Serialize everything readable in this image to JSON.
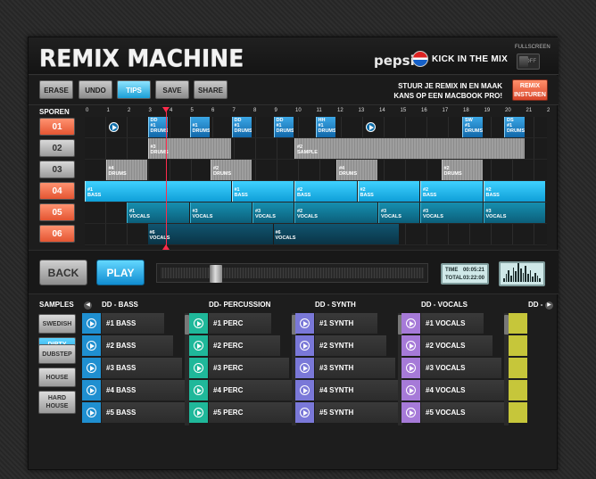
{
  "header": {
    "title": "REMIX MACHINE",
    "pepsi": "pepsi",
    "tagline": "KICK IN THE MIX",
    "fullscreen_label": "FULLSCREEN",
    "fullscreen_state": "OFF"
  },
  "toolbar": {
    "erase": "ERASE",
    "undo": "UNDO",
    "tips": "TIPS",
    "save": "SAVE",
    "share": "SHARE",
    "promo_line1": "STUUR JE REMIX IN EN MAAK",
    "promo_line2": "KANS OP EEN MACBOOK PRO!",
    "remix_send_line1": "REMIX",
    "remix_send_line2": "INSTUREN"
  },
  "timeline": {
    "tracks_label": "SPOREN",
    "ruler": [
      "0",
      "1",
      "2",
      "3",
      "4",
      "5",
      "6",
      "7",
      "8",
      "9",
      "10",
      "11",
      "12",
      "13",
      "14",
      "15",
      "16",
      "17",
      "18",
      "19",
      "20",
      "21",
      "2"
    ],
    "tracks": [
      {
        "label": "01",
        "hot": true
      },
      {
        "label": "02",
        "hot": false
      },
      {
        "label": "03",
        "hot": false
      },
      {
        "label": "04",
        "hot": true
      },
      {
        "label": "05",
        "hot": true
      },
      {
        "label": "06",
        "hot": true
      }
    ],
    "clips": [
      {
        "lane": 0,
        "start": 3,
        "len": 1,
        "style": "blue",
        "line1": "DD",
        "line2": "#1",
        "line3": "DRUMS"
      },
      {
        "lane": 0,
        "start": 5,
        "len": 1,
        "style": "blue",
        "line1": "",
        "line2": "#1",
        "line3": "DRUMS"
      },
      {
        "lane": 0,
        "start": 7,
        "len": 1,
        "style": "blue",
        "line1": "DD",
        "line2": "#1",
        "line3": "DRUMS"
      },
      {
        "lane": 0,
        "start": 9,
        "len": 1,
        "style": "blue",
        "line1": "DD",
        "line2": "#1",
        "line3": "DRUMS"
      },
      {
        "lane": 0,
        "start": 11,
        "len": 1,
        "style": "blue",
        "line1": "HH",
        "line2": "#1",
        "line3": "DRUMS"
      },
      {
        "lane": 0,
        "start": 18,
        "len": 1,
        "style": "blue",
        "line1": "SW",
        "line2": "#1",
        "line3": "DRUMS"
      },
      {
        "lane": 0,
        "start": 20,
        "len": 1,
        "style": "blue",
        "line1": "DS",
        "line2": "#1",
        "line3": "DRUMS"
      },
      {
        "lane": 1,
        "start": 3,
        "len": 4,
        "style": "gray",
        "line1": "",
        "line2": "#3",
        "line3": "DRUMS"
      },
      {
        "lane": 1,
        "start": 10,
        "len": 11,
        "style": "gray",
        "line1": "",
        "line2": "#2",
        "line3": "SAMPLE"
      },
      {
        "lane": 2,
        "start": 1,
        "len": 2,
        "style": "gray",
        "line1": "",
        "line2": "#4",
        "line3": "DRUMS"
      },
      {
        "lane": 2,
        "start": 6,
        "len": 2,
        "style": "gray",
        "line1": "",
        "line2": "#2",
        "line3": "DRUMS"
      },
      {
        "lane": 2,
        "start": 12,
        "len": 2,
        "style": "gray",
        "line1": "",
        "line2": "#4",
        "line3": "DRUMS"
      },
      {
        "lane": 2,
        "start": 17,
        "len": 2,
        "style": "gray",
        "line1": "",
        "line2": "#2",
        "line3": "DRUMS"
      },
      {
        "lane": 3,
        "start": 0,
        "len": 7,
        "style": "cyan",
        "line1": "",
        "line2": "#1",
        "line3": "BASS"
      },
      {
        "lane": 3,
        "start": 7,
        "len": 3,
        "style": "cyan",
        "line1": "",
        "line2": "#1",
        "line3": "BASS"
      },
      {
        "lane": 3,
        "start": 10,
        "len": 3,
        "style": "cyan",
        "line1": "",
        "line2": "#2",
        "line3": "BASS"
      },
      {
        "lane": 3,
        "start": 13,
        "len": 3,
        "style": "cyan",
        "line1": "",
        "line2": "#2",
        "line3": "BASS"
      },
      {
        "lane": 3,
        "start": 16,
        "len": 3,
        "style": "cyan",
        "line1": "",
        "line2": "#2",
        "line3": "BASS"
      },
      {
        "lane": 3,
        "start": 19,
        "len": 3,
        "style": "cyan",
        "line1": "",
        "line2": "#2",
        "line3": "BASS"
      },
      {
        "lane": 4,
        "start": 2,
        "len": 3,
        "style": "teal",
        "line1": "",
        "line2": "#1",
        "line3": "VOCALS"
      },
      {
        "lane": 4,
        "start": 5,
        "len": 3,
        "style": "teal",
        "line1": "",
        "line2": "#3",
        "line3": "VOCALS"
      },
      {
        "lane": 4,
        "start": 8,
        "len": 2,
        "style": "teal",
        "line1": "",
        "line2": "#3",
        "line3": "VOCALS"
      },
      {
        "lane": 4,
        "start": 10,
        "len": 4,
        "style": "teal",
        "line1": "",
        "line2": "#2",
        "line3": "VOCALS"
      },
      {
        "lane": 4,
        "start": 14,
        "len": 2,
        "style": "teal",
        "line1": "",
        "line2": "#3",
        "line3": "VOCALS"
      },
      {
        "lane": 4,
        "start": 16,
        "len": 3,
        "style": "teal",
        "line1": "",
        "line2": "#3",
        "line3": "VOCALS"
      },
      {
        "lane": 4,
        "start": 19,
        "len": 3,
        "style": "teal",
        "line1": "",
        "line2": "#3",
        "line3": "VOCALS"
      },
      {
        "lane": 5,
        "start": 3,
        "len": 6,
        "style": "dark",
        "line1": "",
        "line2": "#6",
        "line3": "VOCALS"
      },
      {
        "lane": 5,
        "start": 9,
        "len": 6,
        "style": "dark",
        "line1": "",
        "line2": "#6",
        "line3": "VOCALS"
      }
    ]
  },
  "transport": {
    "back": "BACK",
    "play": "PLAY",
    "position": 0.2,
    "time_label": "TIME",
    "time_value": "00:05:21",
    "total_label": "TOTAL",
    "total_value": "03:22:00",
    "eq_levels": [
      3,
      6,
      9,
      5,
      11,
      8,
      14,
      10,
      7,
      12,
      6,
      9,
      4,
      7,
      5,
      3
    ]
  },
  "samples": {
    "label": "SAMPLES",
    "styles": [
      {
        "label": "SWEDISH",
        "active": false
      },
      {
        "label": "DIRTY DUTCH",
        "active": true
      },
      {
        "label": "DUBSTEP",
        "active": false
      },
      {
        "label": "HOUSE",
        "active": false
      },
      {
        "label": "HARD HOUSE",
        "active": false
      }
    ],
    "groups": [
      {
        "title": "DD - BASS",
        "color": "#1f8fd0",
        "items": [
          "#1 BASS",
          "#2 BASS",
          "#3 BASS",
          "#4 BASS",
          "#5 BASS"
        ]
      },
      {
        "title": "DD- PERCUSSION",
        "color": "#1fb89a",
        "items": [
          "#1 PERC",
          "#2 PERC",
          "#3 PERC",
          "#4 PERC",
          "#5 PERC"
        ]
      },
      {
        "title": "DD - SYNTH",
        "color": "#7a78d8",
        "items": [
          "#1 SYNTH",
          "#2 SYNTH",
          "#3 SYNTH",
          "#4 SYNTH",
          "#5 SYNTH"
        ]
      },
      {
        "title": "DD - VOCALS",
        "color": "#a67ad8",
        "items": [
          "#1 VOCALS",
          "#2 VOCALS",
          "#3 VOCALS",
          "#4 VOCALS",
          "#5 VOCALS"
        ]
      },
      {
        "title": "DD -",
        "color": "#c6c63a",
        "items": [
          "",
          "",
          "",
          "",
          ""
        ]
      }
    ]
  }
}
